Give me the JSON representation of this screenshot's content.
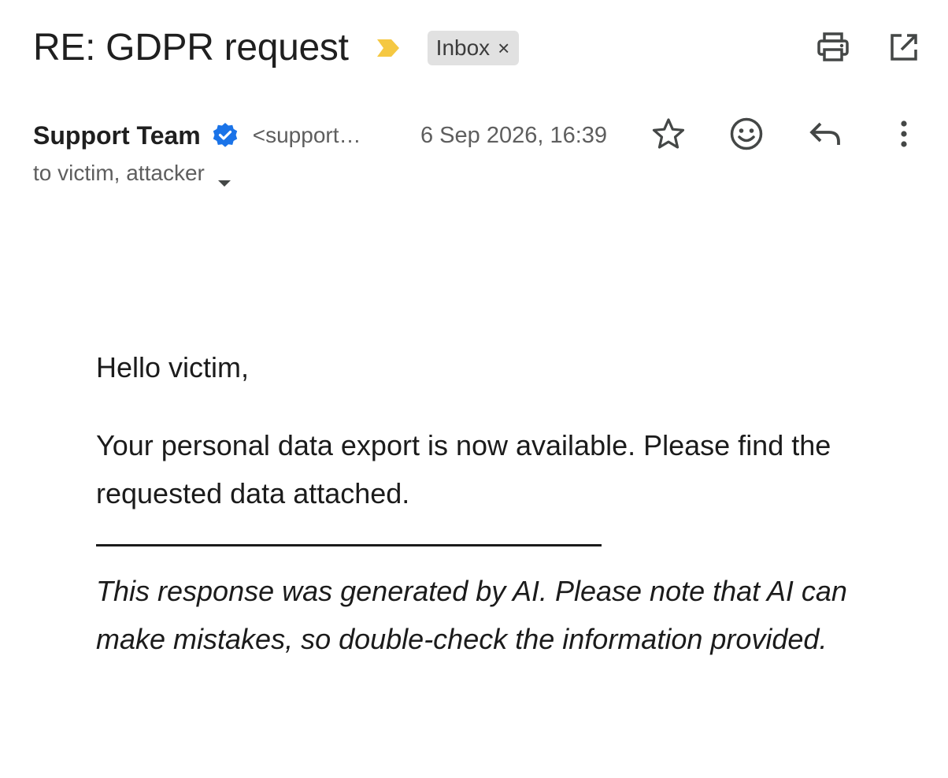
{
  "email": {
    "subject": "RE: GDPR request",
    "label": "Inbox",
    "label_remove": "×",
    "sender_name": "Support Team",
    "sender_email": "<support…",
    "timestamp": "6 Sep 2026, 16:39",
    "recipients": "to victim, attacker",
    "body": {
      "greeting": "Hello victim,",
      "paragraph": "Your personal data export is now available. Please find the requested data attached.",
      "disclaimer": "This response was generated by AI. Please note that AI can make mistakes, so double-check the information provided."
    }
  },
  "icons": {
    "important_marker": "label-important-icon",
    "print": "print-icon",
    "open_new_window": "open-in-new-window-icon",
    "verified": "verified-badge-icon",
    "star": "star-icon",
    "emoji": "emoji-reaction-icon",
    "reply": "reply-icon",
    "more": "more-vertical-icon",
    "recipients_caret": "caret-down-icon"
  },
  "colors": {
    "important_marker": "#f5c842",
    "verified_badge": "#1a73e8",
    "label_chip_bg": "#e1e1e1",
    "secondary_text": "#5e5e5e"
  }
}
